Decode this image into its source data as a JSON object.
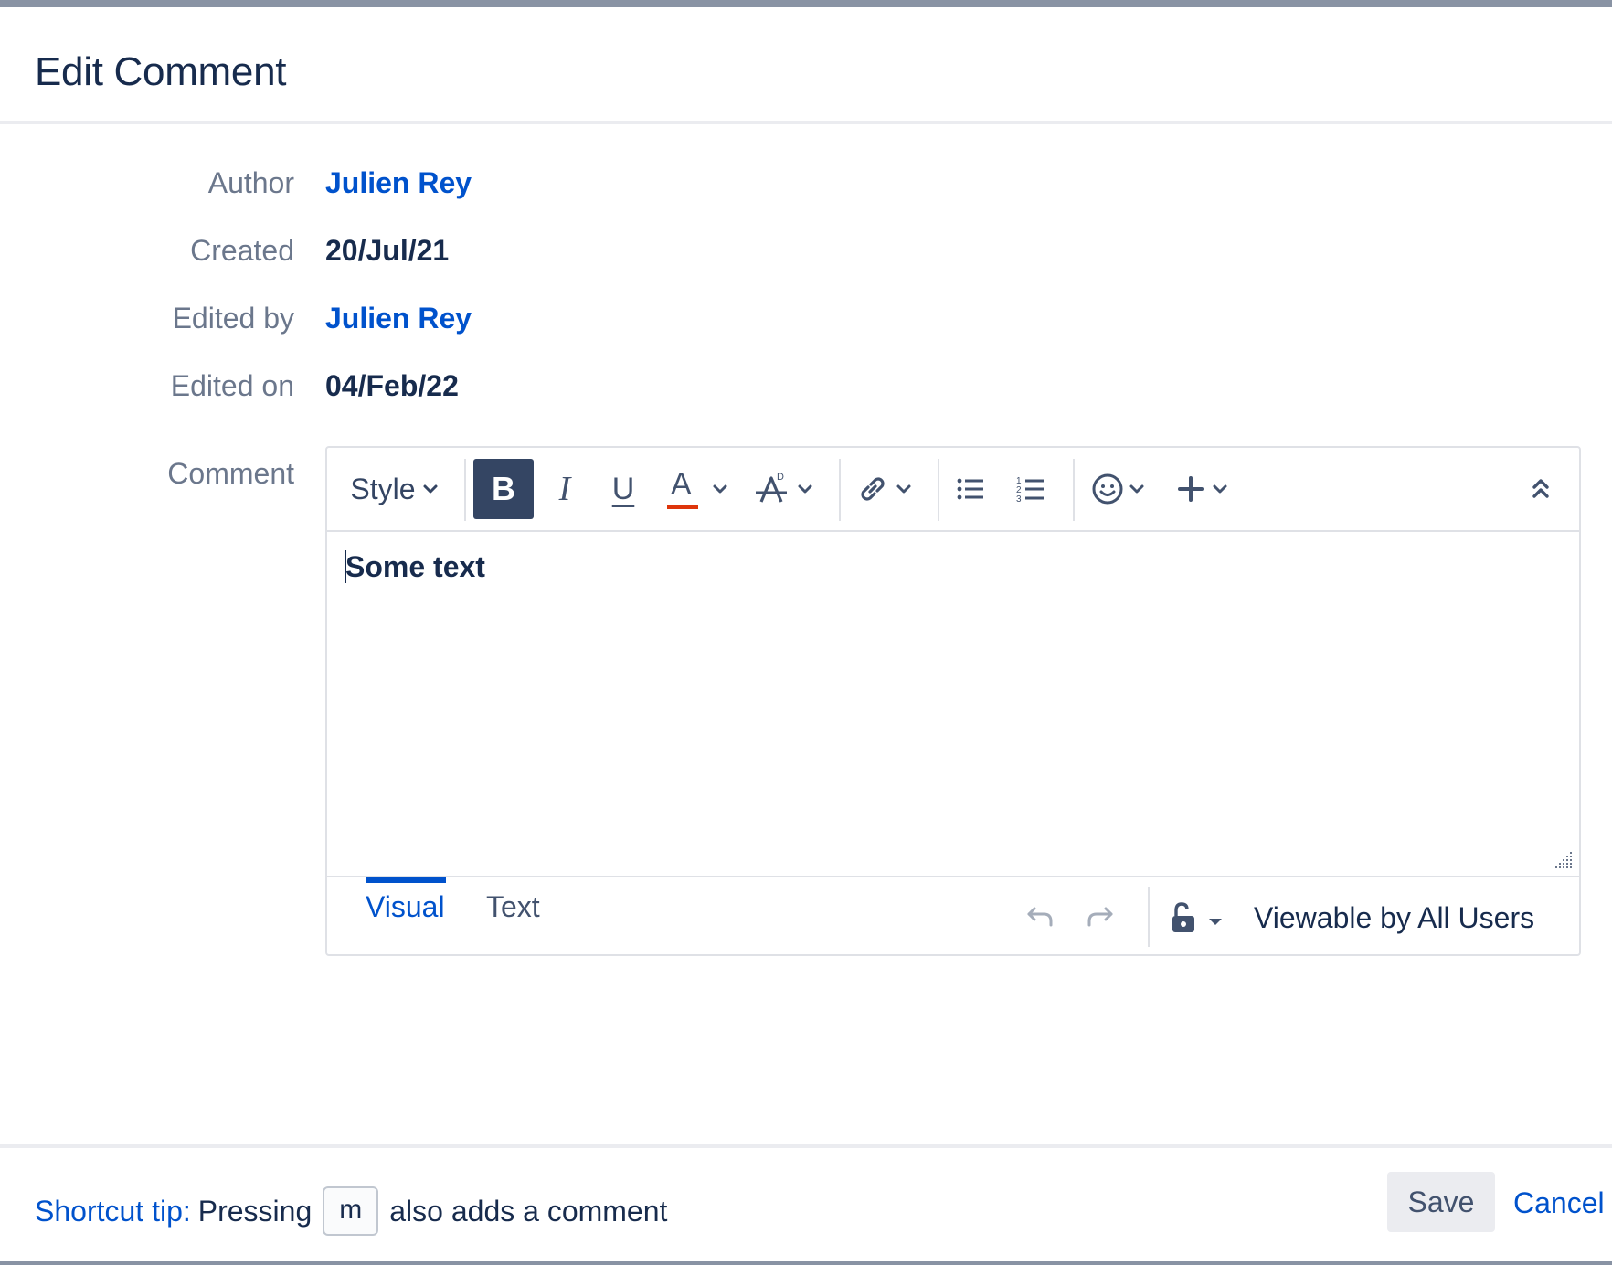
{
  "dialog": {
    "title": "Edit Comment"
  },
  "fields": {
    "author_label": "Author",
    "author_value": "Julien Rey",
    "created_label": "Created",
    "created_value": "20/Jul/21",
    "edited_by_label": "Edited by",
    "edited_by_value": "Julien Rey",
    "edited_on_label": "Edited on",
    "edited_on_value": "04/Feb/22",
    "comment_label": "Comment"
  },
  "toolbar": {
    "style_label": "Style",
    "bold_label": "B",
    "italic_label": "I",
    "underline_label": "U",
    "text_color_label": "A",
    "icons": [
      "chevron-down-icon",
      "strikethrough-icon",
      "link-icon",
      "bullet-list-icon",
      "numbered-list-icon",
      "emoji-icon",
      "plus-icon",
      "collapse-icon"
    ],
    "colors": {
      "active_button": "#344563",
      "text_color_underline": "#de350b"
    }
  },
  "editor": {
    "content": "Some text",
    "tabs": [
      {
        "label": "Visual",
        "active": true
      },
      {
        "label": "Text",
        "active": false
      }
    ],
    "visibility": "Viewable by All Users"
  },
  "footer": {
    "tip_label": "Shortcut tip:",
    "tip_text_before": "Pressing",
    "tip_key": "m",
    "tip_text_after": "also adds a comment",
    "save_label": "Save",
    "cancel_label": "Cancel"
  },
  "colors": {
    "link": "#0052cc",
    "text": "#172b4d",
    "label": "#6b778c",
    "border": "#dfe1e6"
  }
}
